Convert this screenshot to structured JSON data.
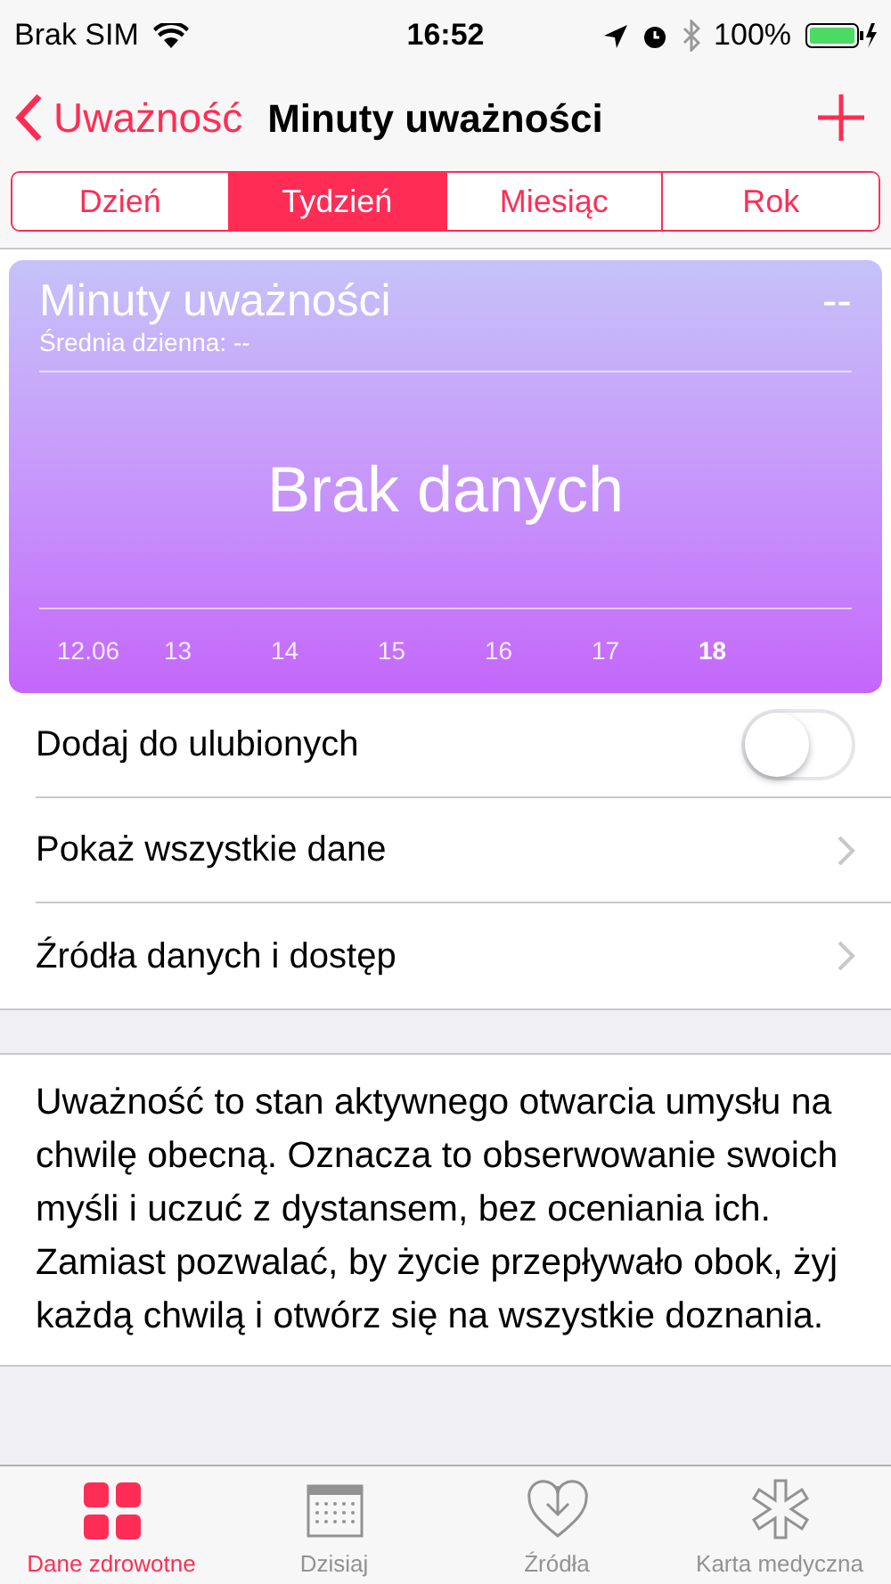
{
  "status_bar": {
    "carrier": "Brak SIM",
    "time": "16:52",
    "battery": "100%"
  },
  "nav": {
    "back": "Uważność",
    "title": "Minuty uważności"
  },
  "segments": [
    {
      "label": "Dzień",
      "selected": false
    },
    {
      "label": "Tydzień",
      "selected": true
    },
    {
      "label": "Miesiąc",
      "selected": false
    },
    {
      "label": "Rok",
      "selected": false
    }
  ],
  "card": {
    "title": "Minuty uważności",
    "value": "--",
    "subtitle": "Średnia dzienna: --",
    "empty_text": "Brak danych",
    "days": [
      {
        "label": "12.06",
        "current": false
      },
      {
        "label": "13",
        "current": false
      },
      {
        "label": "14",
        "current": false
      },
      {
        "label": "15",
        "current": false
      },
      {
        "label": "16",
        "current": false
      },
      {
        "label": "17",
        "current": false
      },
      {
        "label": "18",
        "current": true
      }
    ]
  },
  "rows": [
    {
      "kind": "toggle",
      "label": "Dodaj do ulubionych",
      "on": false
    },
    {
      "kind": "link",
      "label": "Pokaż wszystkie dane"
    },
    {
      "kind": "link",
      "label": "Źródła danych i dostęp"
    }
  ],
  "description": "Uważność to stan aktywnego otwarcia umysłu na chwilę obecną. Oznacza to obserwowanie swoich myśli i uczuć z dystansem, bez oceniania ich. Zamiast pozwalać, by życie przepływało obok, żyj każdą chwilą i otwórz się na wszystkie doznania.",
  "tab_bar": [
    {
      "kind": "grid",
      "label": "Dane zdrowotne",
      "selected": true
    },
    {
      "kind": "calendar",
      "label": "Dzisiaj",
      "selected": false
    },
    {
      "kind": "heart",
      "label": "Źródła",
      "selected": false
    },
    {
      "kind": "asterisk",
      "label": "Karta medyczna",
      "selected": false
    }
  ]
}
